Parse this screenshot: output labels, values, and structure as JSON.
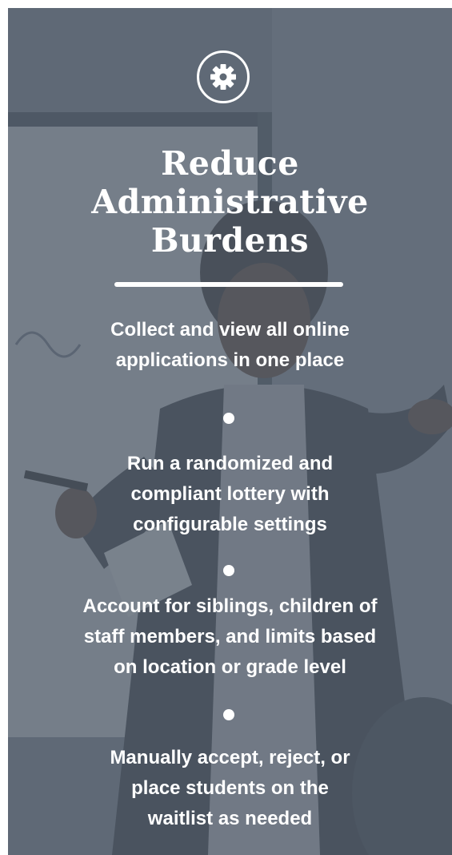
{
  "panel": {
    "icon": "gear-icon",
    "title_lines": [
      "Reduce",
      "Administrative",
      "Burdens"
    ],
    "features": [
      {
        "lines": [
          "Collect and view all online",
          "applications in one place"
        ]
      },
      {
        "lines": [
          "Run a randomized and",
          "compliant lottery with",
          "configurable settings"
        ]
      },
      {
        "lines": [
          "Account for siblings, children of",
          "staff members, and limits based",
          "on location or grade level"
        ]
      },
      {
        "lines": [
          "Manually accept, reject, or",
          "place students on the",
          "waitlist as needed"
        ]
      }
    ]
  },
  "colors": {
    "overlay": "#545f6e",
    "text": "#ffffff"
  }
}
